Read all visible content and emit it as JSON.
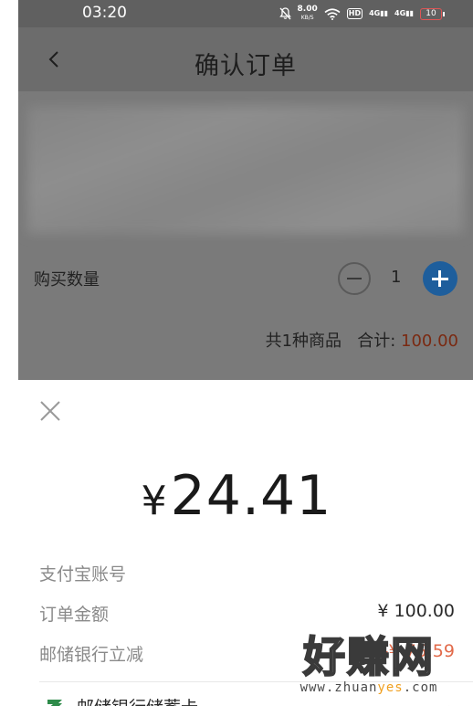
{
  "status_bar": {
    "time": "03:20",
    "net_speed": "8.00",
    "net_speed_unit": "KB/S",
    "hd_badge": "HD",
    "signal_1": "4G",
    "signal_2": "4G",
    "battery": "10"
  },
  "header": {
    "title": "确认订单",
    "back_icon": "chevron-left-icon"
  },
  "order": {
    "quantity_label": "购买数量",
    "quantity": "1",
    "summary_prefix": "共1种商品",
    "total_label": "合计:",
    "total_amount": "100.00"
  },
  "payment_sheet": {
    "close_icon": "close-icon",
    "currency_symbol": "¥",
    "amount": "24.41",
    "rows": [
      {
        "label": "支付宝账号",
        "value": ""
      },
      {
        "label": "订单金额",
        "value": "¥ 100.00"
      },
      {
        "label": "邮储银行立减",
        "value": "-¥ 75.59"
      }
    ],
    "payment_method": "邮储银行储蓄卡",
    "payment_method_icon": "postal-bank-icon"
  },
  "watermark": {
    "title": "好赚网",
    "url_prefix": "www.zhuan",
    "url_highlight": "yes",
    "url_suffix": ".com"
  },
  "colors": {
    "accent_blue": "#1e5e9c",
    "discount_red": "#e26a4a",
    "total_amount_red": "#7a2a12",
    "watermark_orange": "#f0a020"
  }
}
